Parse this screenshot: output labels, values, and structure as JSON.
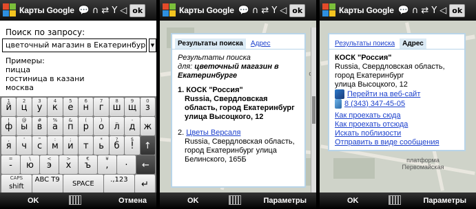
{
  "titlebar": {
    "title": "Карты Google",
    "ok_label": "ok"
  },
  "panel1": {
    "search_label": "Поиск по запросу:",
    "search_value": "цветочный магазин в Екатеринбурге",
    "examples_title": "Примеры:",
    "examples": [
      "пицца",
      "гостиница в казани",
      "москва"
    ],
    "keyboard": {
      "row1": [
        {
          "k": "й",
          "s": "1"
        },
        {
          "k": "ц",
          "s": "2"
        },
        {
          "k": "у",
          "s": "3"
        },
        {
          "k": "к",
          "s": "4"
        },
        {
          "k": "е",
          "s": "5"
        },
        {
          "k": "н",
          "s": "6"
        },
        {
          "k": "г",
          "s": "7"
        },
        {
          "k": "ш",
          "s": "8"
        },
        {
          "k": "щ",
          "s": "9"
        },
        {
          "k": "з",
          "s": "0"
        }
      ],
      "row2": [
        {
          "k": "ф",
          "s": "!"
        },
        {
          "k": "ы",
          "s": "@"
        },
        {
          "k": "в",
          "s": "#"
        },
        {
          "k": "а",
          "s": "%"
        },
        {
          "k": "п",
          "s": "&"
        },
        {
          "k": "р",
          "s": "("
        },
        {
          "k": "о",
          "s": ")"
        },
        {
          "k": "л",
          "s": "_"
        },
        {
          "k": "д",
          "s": "-"
        },
        {
          "k": "ж",
          "s": ""
        }
      ],
      "row3": [
        {
          "k": "я",
          "s": ","
        },
        {
          "k": "ч",
          "s": "'"
        },
        {
          "k": "с",
          "s": "\""
        },
        {
          "k": "м",
          "s": ":"
        },
        {
          "k": "и",
          "s": ";"
        },
        {
          "k": "т",
          "s": ""
        },
        {
          "k": "ь",
          "s": "*"
        },
        {
          "k": "б",
          "s": "?"
        },
        {
          "k": "!",
          "s": "$"
        },
        {
          "k": "↑",
          "s": ""
        }
      ],
      "row4": [
        {
          "k": "-",
          "s": "="
        },
        {
          "k": "ю",
          "s": "\\"
        },
        {
          "k": "э",
          "s": "<"
        },
        {
          "k": "х",
          "s": ">"
        },
        {
          "k": "ъ",
          "s": "€"
        },
        {
          "k": ",",
          "s": "¥"
        },
        {
          "k": "·",
          "s": ""
        },
        {
          "k": "←",
          "s": ""
        }
      ],
      "row5": [
        {
          "k": "shift",
          "s": "CAPS"
        },
        {
          "k": "ABC T9",
          "s": ""
        },
        {
          "k": "SPACE",
          "s": ""
        },
        {
          "k": ".,123",
          "s": ""
        },
        {
          "k": "↵",
          "s": ""
        }
      ]
    },
    "softkeys": {
      "left": "OK",
      "right": "Отмена"
    }
  },
  "panel2": {
    "tab_results": "Результаты поиска",
    "tab_address": "Адрес",
    "results_for_line1": "Результаты поиска",
    "results_for_line2": "для:",
    "results_query": "цветочный магазин в Екатеринбурге",
    "result1_title": "1. КОСК \"Россия\"",
    "result1_address": "Russia, Свердловская область, город Екатеринбург улица Высоцкого, 12",
    "result2_number": "2.",
    "result2_title": "Цветы Версаля",
    "result2_address": "Russia, Свердловская область, город Екатеринбург улица Белинского, 165Б",
    "softkeys": {
      "left": "OK",
      "right": "Параметры"
    },
    "map_label": "ст"
  },
  "panel3": {
    "tab_results": "Результаты поиска",
    "tab_address": "Адрес",
    "place_name": "КОСК \"Россия\"",
    "place_address_1": "Russia, Свердловская область,",
    "place_address_2": "город Екатеринбург",
    "place_address_3": "улица Высоцкого, 12",
    "website_link": "Перейти на веб-сайт",
    "phone_link": "8 (343) 347-45-05",
    "links": [
      "Как проехать сюда",
      "Как проехать отсюда",
      "Искать поблизости",
      "Отправить в виде сообщения"
    ],
    "map_label": "платформа Первомайская",
    "softkeys": {
      "left": "OK",
      "right": "Параметры"
    }
  }
}
